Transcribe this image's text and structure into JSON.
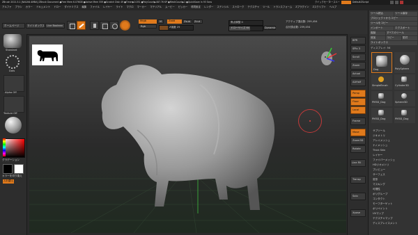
{
  "titlebar": {
    "title": "ZBrush 2021.5.1 [NASAN AMBA]   ZBrush Document   ●Free Mem 6.076GB ●Active Mem 559 ●Scratch Disk 49 ●Timer▶0.051 ●PolyCount▶487.76 KP ●MeshCount▶1 ●QuickSave In 93 Secs",
    "right_items": [
      "クイックセーブ",
      "シースルー",
      "ボタン",
      "DefaultZScript"
    ]
  },
  "menubar": {
    "items": [
      "アルファ",
      "ブラシ",
      "カラー",
      "ドキュメント",
      "ドロー",
      "ダイナミクス",
      "編集",
      "ファイル",
      "レイヤー",
      "ライト",
      "マクロ",
      "マーカー",
      "マテリアル",
      "ムービー",
      "ピッカー",
      "環境設定",
      "レンダー",
      "ステンシル",
      "ストローク",
      "テクスチャ",
      "ツール",
      "トランスフォーム",
      "Zプラグイン",
      "Zスクリプト",
      "ヘルプ"
    ]
  },
  "toolbar": {
    "home_tab": "ホームページ",
    "lightbox_tab": "ライトボックス",
    "liveboolean_tab": "Live Boolean",
    "edit": "Edit",
    "draw": "Draw",
    "move": "Move",
    "scale": "Scale",
    "rotate": "Rotate",
    "mrgb": "Mrgb",
    "rgb": "Rgb",
    "m": "M",
    "zadd": "Zadd",
    "zsub": "Zsub",
    "zcut": "Zcut",
    "rgb_intensity": "RGB強度 100",
    "z_intensity": "Z強度 25",
    "focal_shift": "焦点調整 0",
    "draw_size": "ドローサイズ 64",
    "dynamic": "Dynamic",
    "active_points": "アクティブ頂点数: 259,454",
    "total_points": "合計頂点数: 259,454"
  },
  "leftpanel": {
    "projection_label": "Standard",
    "dots_label": "Dots",
    "alpha_label": "Alpha Off",
    "texture_label": "Texture Off",
    "material_label": "",
    "gradient_label": "グラデーション",
    "switch_label": "カラーを切り換え",
    "alternate_label": "入れ替え"
  },
  "rightpanel": {
    "top_buttons": [
      "ツール読込",
      "ツール保存",
      "プロジェクトからコピー",
      "ツールをコピー",
      "インポート",
      "エクスポート",
      "複製",
      "すべてのツール",
      "追加",
      "コピー",
      "貼付",
      "ライトボックス"
    ],
    "tool_label": "ディスプレイ: 54",
    "tool_thumbs": [
      "Dog",
      "PolySphere",
      "SimpleBrush",
      "Cylinder3D",
      "PM3D_Dog",
      "Sphere3D",
      "PM3D_Dog",
      "PM3D_Dog"
    ],
    "list": [
      "サブツール",
      "ジオメトリ",
      "アレイメッシュ",
      "ナノメッシュ",
      "Thick Skin",
      "レイヤー",
      "ファイバーメッシュ",
      "HDジオメトリ",
      "プレビュー",
      "サーフェス",
      "変形",
      "マスキング",
      "可視性",
      "ポリグループ",
      "コンタクト",
      "モーフターゲット",
      "ポリペイント",
      "UVマップ",
      "テクスチャマップ",
      "ディスプレイスメント"
    ]
  },
  "rightshelf": {
    "buttons": [
      "BPR",
      "SPix 3",
      "Scroll",
      "Zoom",
      "Actual",
      "AAHalf",
      "Persp",
      "Floor",
      "Local",
      "Frame",
      "Move",
      "Zoom3D",
      "Rotate",
      "Line Fill",
      "Transp",
      "Solo",
      "Xpose"
    ]
  },
  "viewport": {
    "model": "cow sculpt"
  }
}
